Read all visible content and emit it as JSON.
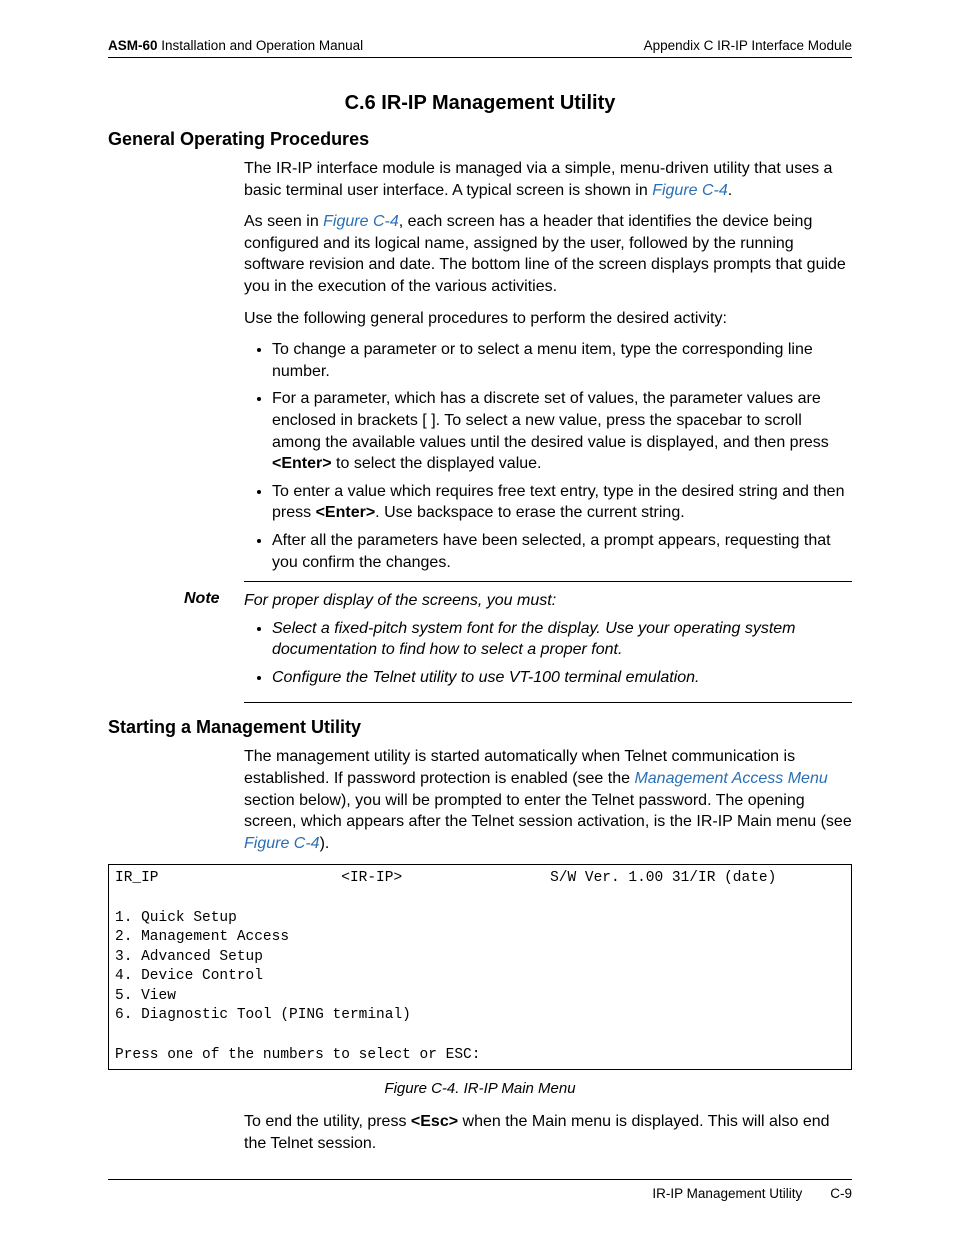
{
  "header": {
    "product": "ASM-60",
    "manual": "Installation and Operation Manual",
    "appendix": "Appendix C  IR-IP Interface Module"
  },
  "section": {
    "number_title": "C.6  IR-IP Management Utility"
  },
  "sub1": {
    "title": "General Operating Procedures",
    "p1a": "The IR-IP interface module is managed via a simple, menu-driven utility that uses a basic terminal user interface. A typical screen is shown in ",
    "p1_link": "Figure C-4",
    "p1b": ".",
    "p2a": "As seen in ",
    "p2_link": "Figure C-4",
    "p2b": ", each screen has a header that identifies the device being configured and its logical name, assigned by the user, followed by the running software revision and date. The bottom line of the screen displays prompts that guide you in the execution of the various activities.",
    "p3": "Use the following general procedures to perform the desired activity:",
    "bullets": {
      "b1": "To change a parameter or to select a menu item, type the corresponding line number.",
      "b2a": "For a parameter, which has a discrete set of values, the parameter values are enclosed in brackets [ ]. To select a new value, press the spacebar to scroll among the available values until the desired value is displayed, and then press ",
      "b2_key": "<Enter>",
      "b2b": " to select the displayed value.",
      "b3a": "To enter a value which requires free text entry, type in the desired string and then press ",
      "b3_key": "<Enter>",
      "b3b": ". Use backspace to erase the current string.",
      "b4": "After all the parameters have been selected, a prompt appears, requesting that you confirm the changes."
    },
    "note_label": "Note",
    "note_intro": "For proper display of the screens, you must:",
    "note_bullets": {
      "n1": "Select a fixed-pitch system font for the display. Use your operating system documentation to find how to select a proper font.",
      "n2": "Configure the Telnet utility to use VT-100 terminal emulation."
    }
  },
  "sub2": {
    "title": "Starting a Management Utility",
    "p1a": "The management utility is started automatically when Telnet communication is established. If password protection is enabled (see the ",
    "p1_link": "Management Access Menu",
    "p1b": " section below), you will be prompted to enter the Telnet password. The opening screen, which appears after the Telnet session activation, is the IR-IP Main menu (see ",
    "p1_link2": "Figure C-4",
    "p1c": ").",
    "terminal": "IR_IP                     <IR-IP>                 S/W Ver. 1.00 31/IR (date)\n\n1. Quick Setup\n2. Management Access\n3. Advanced Setup\n4. Device Control\n5. View\n6. Diagnostic Tool (PING terminal)\n\nPress one of the numbers to select or ESC:",
    "caption": "Figure C-4.  IR-IP Main Menu",
    "p2a": "To end the utility, press ",
    "p2_key": "<Esc>",
    "p2b": " when the Main menu is displayed. This will also end the Telnet session."
  },
  "footer": {
    "section": "IR-IP Management Utility",
    "page": "C-9"
  }
}
